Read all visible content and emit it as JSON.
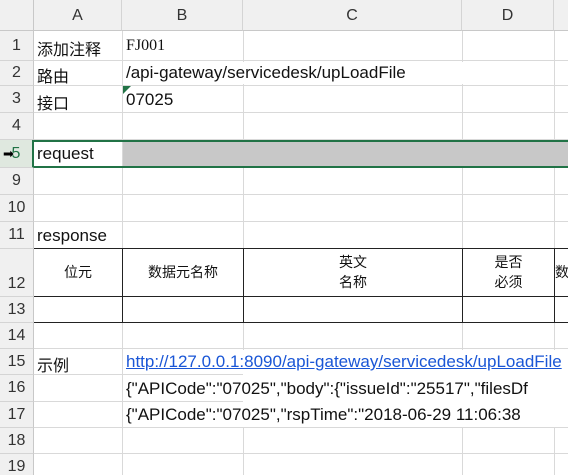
{
  "columns": [
    "A",
    "B",
    "C",
    "D"
  ],
  "rows": [
    "1",
    "2",
    "3",
    "4",
    "5",
    "9",
    "10",
    "11",
    "12",
    "13",
    "14",
    "15",
    "16",
    "17",
    "18",
    "19"
  ],
  "cells": {
    "a1": "添加注释",
    "b1": "FJ001",
    "a2": "路由",
    "b2": "/api-gateway/servicedesk/upLoadFile",
    "a3": "接口",
    "b3": "07025",
    "a5": "request",
    "a11": "response",
    "a15": "示例",
    "b15": "http://127.0.0.1:8090/api-gateway/servicedesk/upLoadFile",
    "b16": "{\"APICode\":\"07025\",\"body\":{\"issueId\":\"25517\",\"filesDf",
    "b17": "{\"APICode\":\"07025\",\"rspTime\":\"2018-06-29 11:06:38"
  },
  "table_headers": {
    "col1": "位元",
    "col2": "数据元名称",
    "col3_line1": "英文",
    "col3_line2": "名称",
    "col4_line1": "是否",
    "col4_line2": "必须",
    "col5": "数"
  },
  "selected_row": "5",
  "colors": {
    "accent_green": "#217346",
    "link_blue": "#1a56d6",
    "header_gray": "#f0f0f0",
    "fill_gray": "#c8c8c8"
  }
}
